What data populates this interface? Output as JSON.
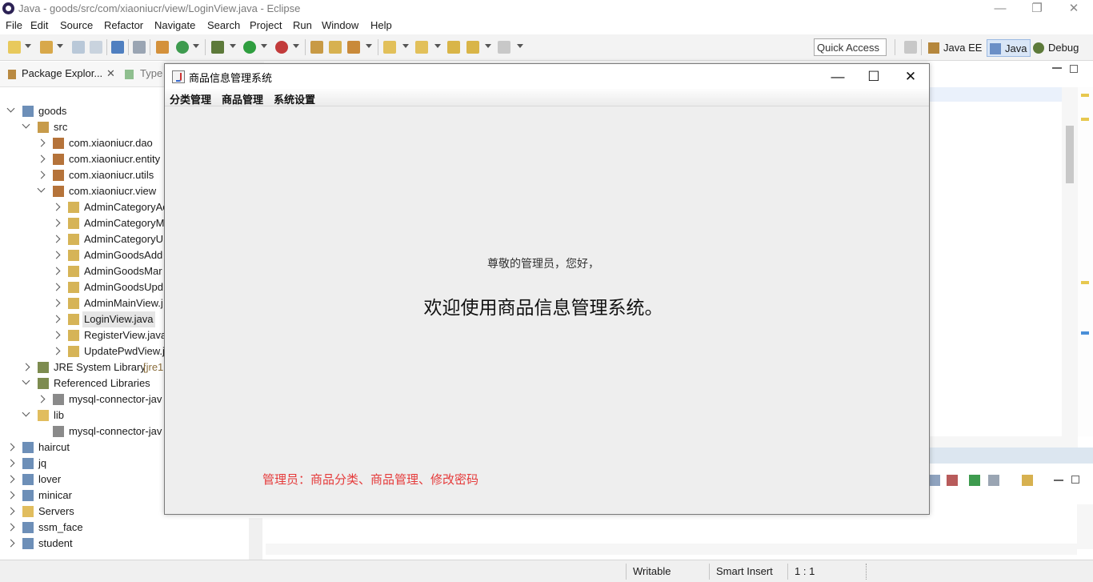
{
  "eclipse": {
    "title": "Java - goods/src/com/xiaoniucr/view/LoginView.java - Eclipse",
    "window_controls": {
      "minimize": "—",
      "restore": "❐",
      "close": "✕"
    },
    "menu": [
      "File",
      "Edit",
      "Source",
      "Refactor",
      "Navigate",
      "Search",
      "Project",
      "Run",
      "Window",
      "Help"
    ],
    "quick_access": "Quick Access",
    "perspectives": [
      "Java EE",
      "Java",
      "Debug"
    ],
    "active_perspective": "Java"
  },
  "package_explorer": {
    "tab_label": "Package Explor...",
    "tab_close": "✕",
    "second_tab": "Type",
    "tree": [
      {
        "label": "goods",
        "state": "open",
        "icon": "project-icon"
      },
      {
        "label": "src",
        "state": "open",
        "icon": "source-folder-icon"
      },
      {
        "label": "com.xiaoniucr.dao",
        "state": "closed",
        "icon": "package-icon"
      },
      {
        "label": "com.xiaoniucr.entity",
        "state": "closed",
        "icon": "package-icon"
      },
      {
        "label": "com.xiaoniucr.utils",
        "state": "closed",
        "icon": "package-icon"
      },
      {
        "label": "com.xiaoniucr.view",
        "state": "open",
        "icon": "package-icon"
      },
      {
        "label": "AdminCategoryAc",
        "state": "closed",
        "icon": "java-file-icon"
      },
      {
        "label": "AdminCategoryM",
        "state": "closed",
        "icon": "java-file-icon"
      },
      {
        "label": "AdminCategoryU",
        "state": "closed",
        "icon": "java-file-icon"
      },
      {
        "label": "AdminGoodsAdd",
        "state": "closed",
        "icon": "java-file-icon"
      },
      {
        "label": "AdminGoodsMar",
        "state": "closed",
        "icon": "java-file-icon"
      },
      {
        "label": "AdminGoodsUpd",
        "state": "closed",
        "icon": "java-file-icon"
      },
      {
        "label": "AdminMainView.j",
        "state": "closed",
        "icon": "java-file-icon"
      },
      {
        "label": "LoginView.java",
        "state": "closed",
        "icon": "java-file-icon",
        "selected": true
      },
      {
        "label": "RegisterView.java",
        "state": "closed",
        "icon": "java-file-icon"
      },
      {
        "label": "UpdatePwdView.j",
        "state": "closed",
        "icon": "java-file-icon"
      },
      {
        "label": "JRE System Library",
        "suffix": "[jre1",
        "state": "closed",
        "icon": "library-icon"
      },
      {
        "label": "Referenced Libraries",
        "state": "open",
        "icon": "library-icon"
      },
      {
        "label": "mysql-connector-jav",
        "state": "closed",
        "icon": "jar-icon"
      },
      {
        "label": "lib",
        "state": "open",
        "icon": "folder-icon"
      },
      {
        "label": "mysql-connector-jav",
        "state": "none",
        "icon": "jar-icon"
      },
      {
        "label": "haircut",
        "state": "closed",
        "icon": "project-icon"
      },
      {
        "label": "jq",
        "state": "closed",
        "icon": "project-icon"
      },
      {
        "label": "lover",
        "state": "closed",
        "icon": "project-icon"
      },
      {
        "label": "minicar",
        "state": "closed",
        "icon": "project-icon"
      },
      {
        "label": "Servers",
        "state": "closed",
        "icon": "folder-icon"
      },
      {
        "label": "ssm_face",
        "state": "closed",
        "icon": "project-icon"
      },
      {
        "label": "student",
        "state": "closed",
        "icon": "project-icon"
      }
    ]
  },
  "status_bar": {
    "writable": "Writable",
    "insert_mode": "Smart Insert",
    "position": "1 : 1"
  },
  "swing_window": {
    "title": "商品信息管理系统",
    "controls": {
      "minimize": "—",
      "maximize": "☐",
      "close": "✕"
    },
    "menu": [
      "分类管理",
      "商品管理",
      "系统设置"
    ],
    "greeting": "尊敬的管理员，您好，",
    "welcome": "欢迎使用商品信息管理系统。",
    "admin_note": "管理员：商品分类、商品管理、修改密码"
  },
  "colors": {
    "accent_red": "#e53a3a",
    "selection": "#e5e5e5",
    "active_perspective_bg": "#d9e6f7"
  }
}
